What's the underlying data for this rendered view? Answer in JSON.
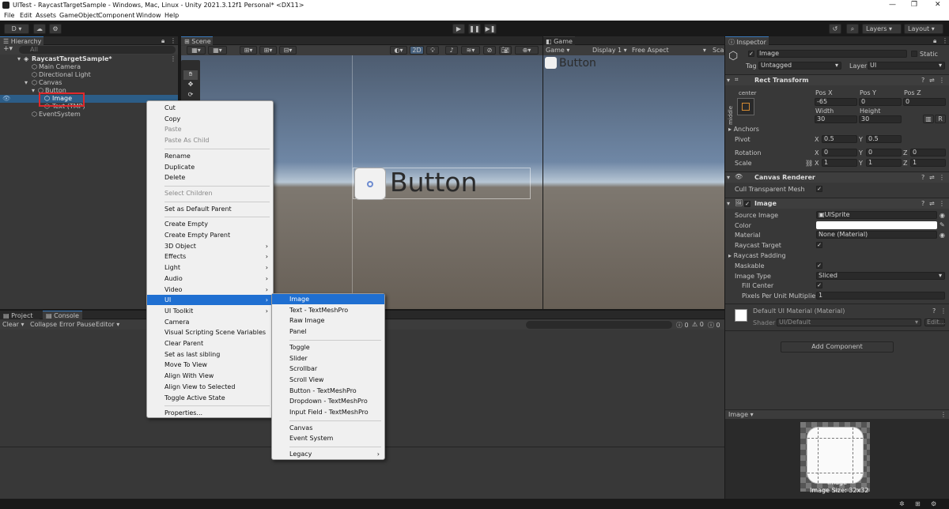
{
  "window": {
    "title": "UITest - RaycastTargetSample - Windows, Mac, Linux - Unity 2021.3.12f1 Personal* <DX11>",
    "minimize": "—",
    "maximize": "❐",
    "close": "✕"
  },
  "menubar": [
    "File",
    "Edit",
    "Assets",
    "GameObject",
    "Component",
    "Window",
    "Help"
  ],
  "toolbar": {
    "account": "D",
    "play": "▶",
    "pause": "❚❚",
    "step": "▶❚",
    "layers": "Layers",
    "layout": "Layout"
  },
  "hierarchy": {
    "tab": "Hierarchy",
    "search_placeholder": "All",
    "scene": "RaycastTargetSample*",
    "items": [
      "Main Camera",
      "Directional Light",
      "Canvas",
      "Button",
      "Image",
      "Text (TMP)",
      "EventSystem"
    ]
  },
  "scene": {
    "tab": "Scene",
    "mode2d": "2D",
    "button_text": "Button"
  },
  "game": {
    "tab": "Game",
    "dropdown": "Game",
    "display": "Display 1",
    "aspect": "Free Aspect",
    "scale": "Sca",
    "button_text": "Button"
  },
  "console": {
    "tab_project": "Project",
    "tab_console": "Console",
    "clear": "Clear",
    "collapse": "Collapse",
    "error_pause": "Error Pause",
    "editor": "Editor",
    "count_log": "0",
    "count_warn": "0",
    "count_err": "0"
  },
  "inspector": {
    "tab": "Inspector",
    "object_name": "Image",
    "static_label": "Static",
    "tag_label": "Tag",
    "tag_value": "Untagged",
    "layer_label": "Layer",
    "layer_value": "UI",
    "rect": {
      "title": "Rect Transform",
      "anchor_h": "center",
      "anchor_v": "middle",
      "posx_l": "Pos X",
      "posy_l": "Pos Y",
      "posz_l": "Pos Z",
      "posx": "-65",
      "posy": "0",
      "posz": "0",
      "w_l": "Width",
      "h_l": "Height",
      "w": "30",
      "h": "30",
      "r": "R",
      "anchors": "Anchors",
      "pivot": "Pivot",
      "pivot_x": "0.5",
      "pivot_y": "0.5",
      "rotation": "Rotation",
      "rot_x": "0",
      "rot_y": "0",
      "rot_z": "0",
      "scale": "Scale",
      "sc_x": "1",
      "sc_y": "1",
      "sc_z": "1"
    },
    "canvas_renderer": {
      "title": "Canvas Renderer",
      "cull": "Cull Transparent Mesh"
    },
    "image": {
      "title": "Image",
      "source_l": "Source Image",
      "source": "UISprite",
      "color_l": "Color",
      "material_l": "Material",
      "material": "None (Material)",
      "raycast_target": "Raycast Target",
      "raycast_padding": "Raycast Padding",
      "maskable": "Maskable",
      "image_type_l": "Image Type",
      "image_type": "Sliced",
      "fill_center": "Fill Center",
      "ppu_l": "Pixels Per Unit Multiplier",
      "ppu": "1"
    },
    "material_block": {
      "title": "Default UI Material (Material)",
      "shader_l": "Shader",
      "shader": "UI/Default",
      "edit": "Edit..."
    },
    "add_component": "Add Component",
    "preview": {
      "label": "Image",
      "caption": "Image",
      "size": "Image Size: 32x32"
    }
  },
  "context_menu": [
    {
      "label": "Cut"
    },
    {
      "label": "Copy"
    },
    {
      "label": "Paste",
      "disabled": true
    },
    {
      "label": "Paste As Child",
      "disabled": true
    },
    {
      "sep": true
    },
    {
      "label": "Rename"
    },
    {
      "label": "Duplicate"
    },
    {
      "label": "Delete"
    },
    {
      "sep": true
    },
    {
      "label": "Select Children",
      "disabled": true
    },
    {
      "sep": true
    },
    {
      "label": "Set as Default Parent"
    },
    {
      "sep": true
    },
    {
      "label": "Create Empty"
    },
    {
      "label": "Create Empty Parent"
    },
    {
      "label": "3D Object",
      "sub": true
    },
    {
      "label": "Effects",
      "sub": true
    },
    {
      "label": "Light",
      "sub": true
    },
    {
      "label": "Audio",
      "sub": true
    },
    {
      "label": "Video",
      "sub": true
    },
    {
      "label": "UI",
      "sub": true,
      "selected": true
    },
    {
      "label": "UI Toolkit",
      "sub": true
    },
    {
      "label": "Camera"
    },
    {
      "label": "Visual Scripting Scene Variables"
    },
    {
      "label": "Clear Parent"
    },
    {
      "label": "Set as last sibling"
    },
    {
      "label": "Move To View"
    },
    {
      "label": "Align With View"
    },
    {
      "label": "Align View to Selected"
    },
    {
      "label": "Toggle Active State"
    },
    {
      "sep": true
    },
    {
      "label": "Properties..."
    }
  ],
  "ui_submenu": [
    {
      "label": "Image",
      "selected": true
    },
    {
      "label": "Text - TextMeshPro"
    },
    {
      "label": "Raw Image"
    },
    {
      "label": "Panel"
    },
    {
      "sep": true
    },
    {
      "label": "Toggle"
    },
    {
      "label": "Slider"
    },
    {
      "label": "Scrollbar"
    },
    {
      "label": "Scroll View"
    },
    {
      "label": "Button - TextMeshPro"
    },
    {
      "label": "Dropdown - TextMeshPro"
    },
    {
      "label": "Input Field - TextMeshPro"
    },
    {
      "sep": true
    },
    {
      "label": "Canvas"
    },
    {
      "label": "Event System"
    },
    {
      "sep": true
    },
    {
      "label": "Legacy",
      "sub": true
    }
  ]
}
